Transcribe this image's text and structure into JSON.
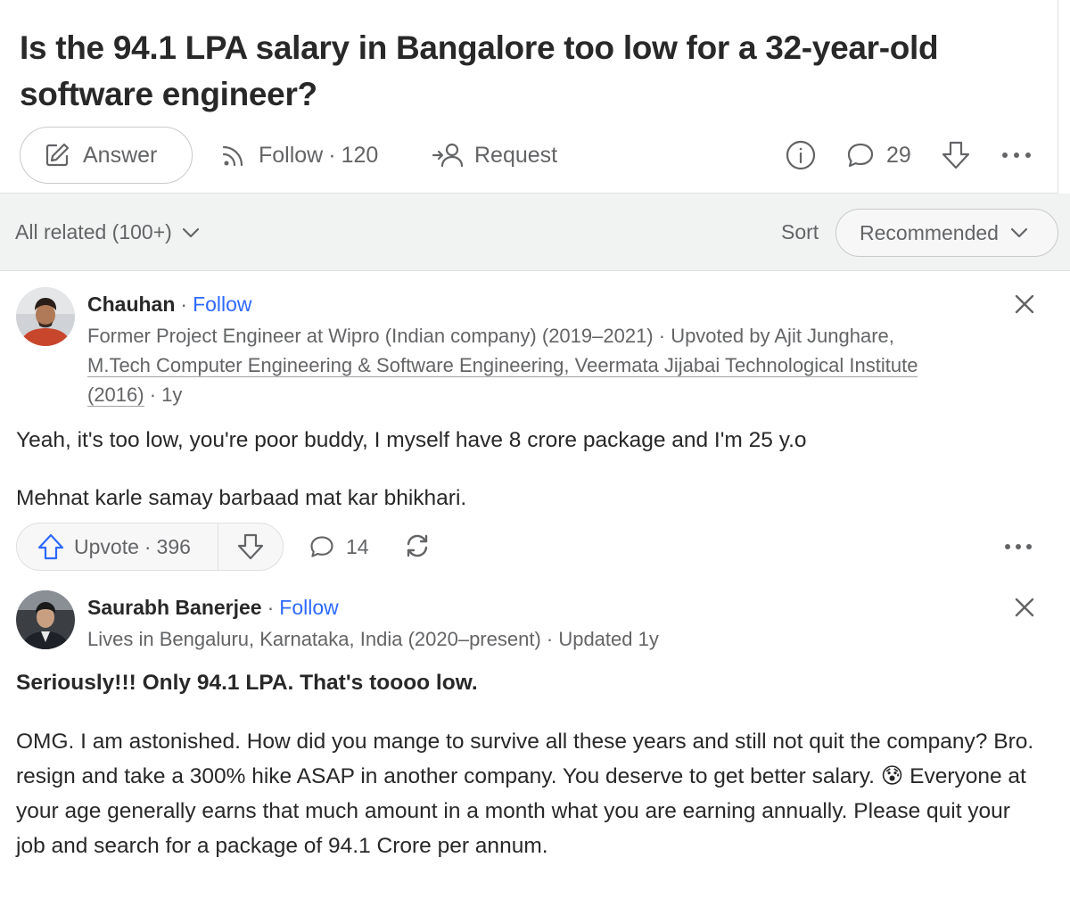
{
  "question": {
    "title": "Is the 94.1 LPA salary in Bangalore too low for a 32-year-old software engineer?",
    "answer_label": "Answer",
    "follow_label": "Follow",
    "follow_count": "120",
    "request_label": "Request",
    "comment_count": "29"
  },
  "sort_bar": {
    "related_label": "All related (100+)",
    "sort_label": "Sort",
    "sort_value": "Recommended"
  },
  "answers": [
    {
      "author": "Chauhan",
      "follow": "Follow",
      "credential_a": "Former Project Engineer at Wipro (Indian company) (2019–2021) · Upvoted by Ajit Junghare,",
      "credential_b": "M.Tech Computer Engineering & Software Engineering, Veermata Jijabai Technological Institute",
      "credential_c": "(2016)",
      "age": " · 1y",
      "paragraphs": [
        "Yeah, it's too low, you're poor buddy, I myself have 8 crore package and I'm 25 y.o",
        "Mehnat karle samay barbaad mat kar bhikhari."
      ],
      "upvote_label": "Upvote",
      "upvote_count": "396",
      "comment_count": "14"
    },
    {
      "author": "Saurabh Banerjee",
      "follow": "Follow",
      "credential": "Lives in Bengaluru, Karnataka, India (2020–present) · Updated 1y",
      "headline": "Seriously!!! Only 94.1 LPA. That's toooo low.",
      "body_part1": "OMG. I am astonished. How did you mange to survive all these years and still not quit the company? Bro. resign and take a 300% hike ASAP in another company. You deserve to get better salary. ",
      "emoji": "😰",
      "body_part2": " Everyone at your age generally earns that much amount in a month what you are earning annually. Please quit your job and search for a package of 94.1 Crore per annum."
    }
  ],
  "colors": {
    "link": "#2e69ff",
    "text": "#282829",
    "muted": "#636466",
    "sort_bar_bg": "#f1f2f2"
  }
}
